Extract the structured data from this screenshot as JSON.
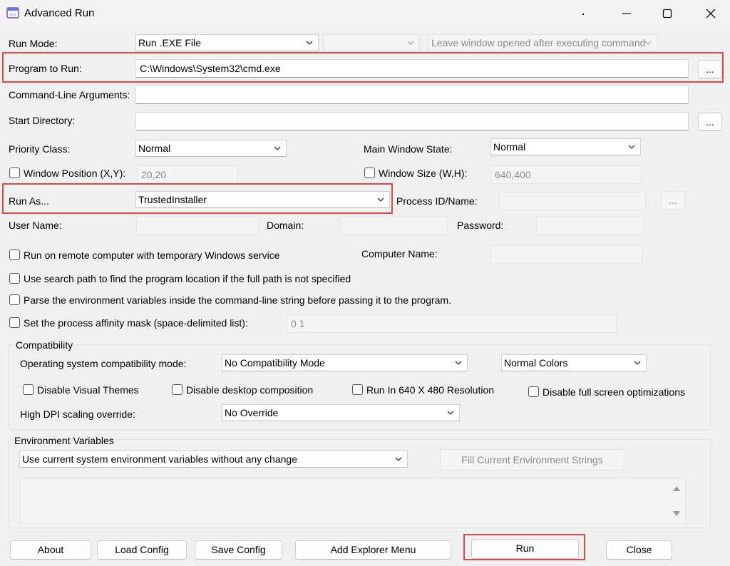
{
  "window": {
    "title": "Advanced Run",
    "controls": {
      "minimize": "—",
      "maximize": "☐",
      "close": "✕",
      "dot": "."
    }
  },
  "run_mode": {
    "label": "Run Mode:",
    "value": "Run .EXE File",
    "secondary_value": "",
    "after_exec_value": "Leave window opened after executing command"
  },
  "program": {
    "label": "Program to Run:",
    "value": "C:\\Windows\\System32\\cmd.exe",
    "browse": "..."
  },
  "args": {
    "label": "Command-Line Arguments:",
    "value": ""
  },
  "start_dir": {
    "label": "Start Directory:",
    "value": "",
    "browse": "..."
  },
  "priority": {
    "label": "Priority Class:",
    "value": "Normal"
  },
  "main_window_state": {
    "label": "Main Window State:",
    "value": "Normal"
  },
  "window_position": {
    "label": "Window Position (X,Y):",
    "value": "20,20"
  },
  "window_size": {
    "label": "Window Size (W,H):",
    "value": "640,400"
  },
  "run_as": {
    "label": "Run As...",
    "value": "TrustedInstaller"
  },
  "process_id": {
    "label": "Process ID/Name:",
    "value": "",
    "browse": "..."
  },
  "credentials": {
    "user_label": "User Name:",
    "user_value": "",
    "domain_label": "Domain:",
    "domain_value": "",
    "password_label": "Password:",
    "password_value": ""
  },
  "options": {
    "remote": "Run on remote computer with temporary Windows service",
    "computer_name_label": "Computer Name:",
    "computer_name_value": "",
    "search_path": "Use search path to find the program location if the full path is not specified",
    "parse_env": "Parse the environment variables inside the command-line string before passing it to the program.",
    "affinity": "Set the process affinity mask (space-delimited list):",
    "affinity_value": "0 1"
  },
  "compatibility": {
    "title": "Compatibility",
    "os_mode_label": "Operating system compatibility mode:",
    "os_mode_value": "No Compatibility Mode",
    "colors_value": "Normal Colors",
    "disable_visual_themes": "Disable Visual Themes",
    "disable_desktop_composition": "Disable desktop composition",
    "run_640": "Run In 640 X 480 Resolution",
    "disable_fullscreen_opt": "Disable full screen optimizations",
    "dpi_label": "High DPI scaling override:",
    "dpi_value": "No Override"
  },
  "environment": {
    "title": "Environment Variables",
    "mode_value": "Use current system environment variables without any change",
    "fill_button": "Fill Current Environment Strings"
  },
  "buttons": {
    "about": "About",
    "load_config": "Load Config",
    "save_config": "Save Config",
    "add_explorer_menu": "Add Explorer Menu",
    "run": "Run",
    "close": "Close"
  },
  "colors": {
    "highlight": "#e04848",
    "background": "#f0f0f0"
  },
  "icons": {
    "app": "app-window-icon",
    "dropdown": "chevron-down-icon",
    "scroll_up": "triangle-up-icon",
    "scroll_down": "triangle-down-icon"
  }
}
